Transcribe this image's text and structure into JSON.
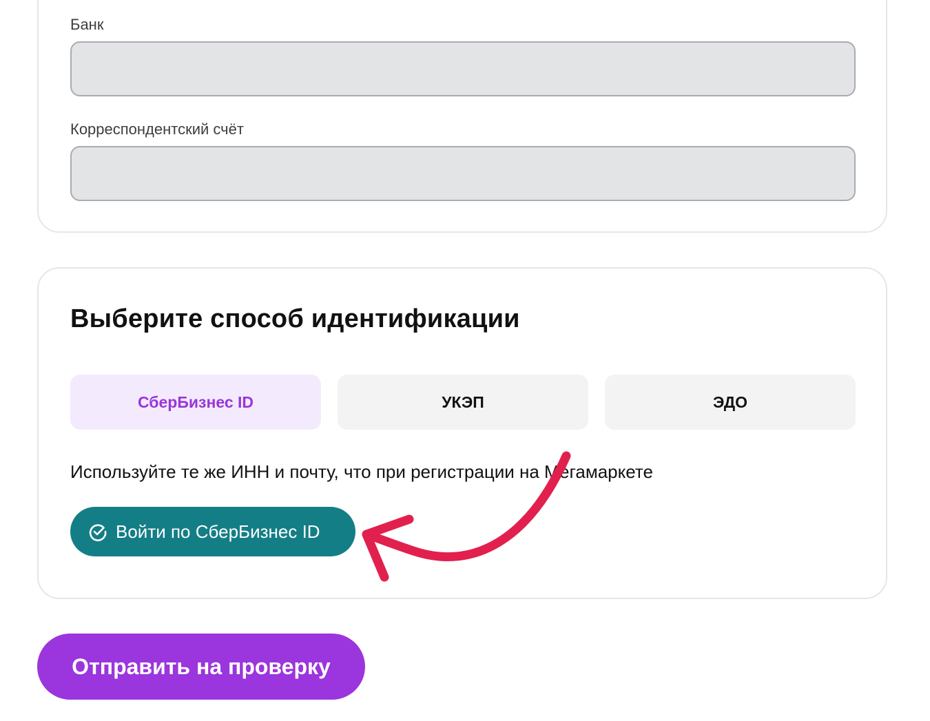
{
  "bank_section": {
    "bank_label": "Банк",
    "bank_value": "",
    "corr_account_label": "Корреспондентский счёт",
    "corr_account_value": ""
  },
  "identification": {
    "title": "Выберите способ идентификации",
    "tabs": [
      {
        "label": "СберБизнес ID",
        "active": true
      },
      {
        "label": "УКЭП",
        "active": false
      },
      {
        "label": "ЭДО",
        "active": false
      }
    ],
    "hint": "Используйте те же ИНН и почту, что при регистрации на Мегамаркете",
    "login_button_label": "Войти по СберБизнес ID",
    "login_button_icon": "check-circle-icon"
  },
  "submit_button_label": "Отправить на проверку",
  "colors": {
    "accent_purple": "#9b35dd",
    "active_tab_bg": "#f3ebfd",
    "teal_button": "#147e86",
    "annotation_arrow": "#e2204e"
  }
}
